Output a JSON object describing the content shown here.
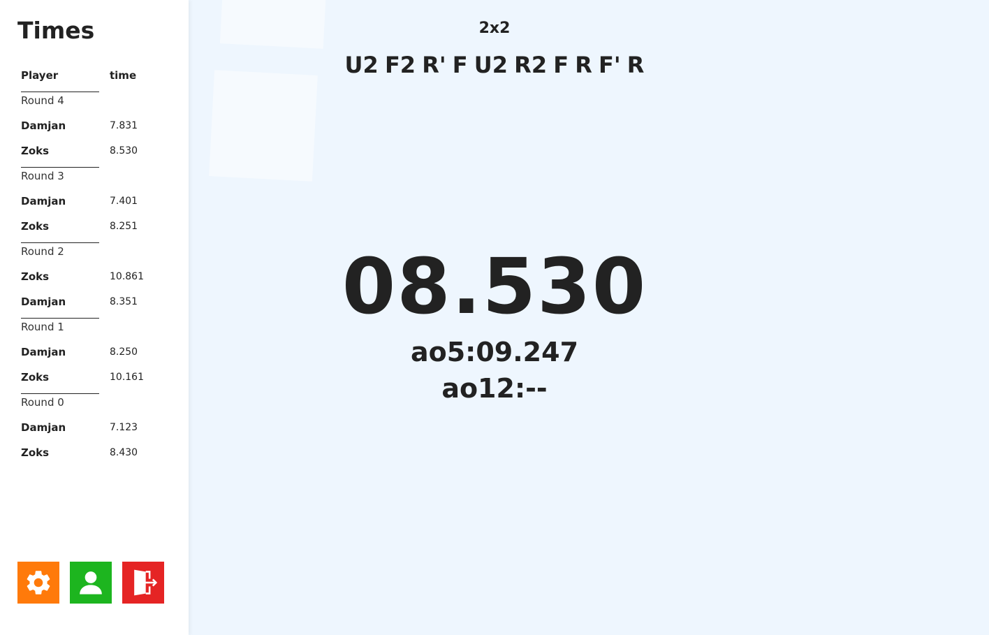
{
  "sidebar": {
    "title": "Times",
    "headers": {
      "player": "Player",
      "time": "time"
    },
    "rounds": [
      {
        "label": "Round 4",
        "entries": [
          {
            "player": "Damjan",
            "time": "7.831"
          },
          {
            "player": "Zoks",
            "time": "8.530"
          }
        ]
      },
      {
        "label": "Round 3",
        "entries": [
          {
            "player": "Damjan",
            "time": "7.401"
          },
          {
            "player": "Zoks",
            "time": "8.251"
          }
        ]
      },
      {
        "label": "Round 2",
        "entries": [
          {
            "player": "Zoks",
            "time": "10.861"
          },
          {
            "player": "Damjan",
            "time": "8.351"
          }
        ]
      },
      {
        "label": "Round 1",
        "entries": [
          {
            "player": "Damjan",
            "time": "8.250"
          },
          {
            "player": "Zoks",
            "time": "10.161"
          }
        ]
      },
      {
        "label": "Round 0",
        "entries": [
          {
            "player": "Damjan",
            "time": "7.123"
          },
          {
            "player": "Zoks",
            "time": "8.430"
          }
        ]
      }
    ],
    "buttons": {
      "settings_icon": "gear-icon",
      "profile_icon": "user-icon",
      "logout_icon": "logout-door-icon"
    }
  },
  "main": {
    "puzzle_type": "2x2",
    "scramble": "U2 F2 R' F U2 R2 F R F' R",
    "timer": "08.530",
    "ao5": "ao5:09.247",
    "ao12": "ao12:--"
  },
  "colors": {
    "settings": "#ff7a0a",
    "profile": "#1db51f",
    "logout": "#e52424",
    "background": "#eef6fe"
  }
}
